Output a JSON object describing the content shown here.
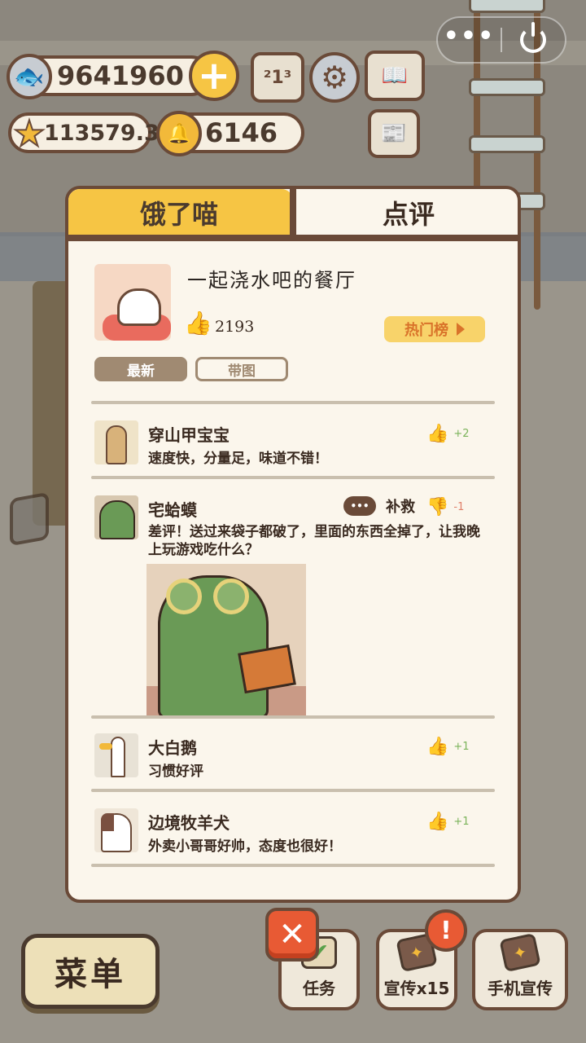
{
  "hud": {
    "fish": "9641960",
    "stars": "113579.3",
    "bells": "6146",
    "plus_label": "+",
    "rank_label": "²1³"
  },
  "panel": {
    "tabs": [
      "饿了喵",
      "点评"
    ],
    "restaurant_name": "一起浇水吧的餐厅",
    "likes": "2193",
    "hot_list_label": "热门榜",
    "filters": [
      "最新",
      "带图"
    ]
  },
  "reviews": [
    {
      "name": "穿山甲宝宝",
      "text": "速度快，分量足，味道不错！",
      "vote": "+2"
    },
    {
      "name": "宅蛤蟆",
      "text": "差评！送过来袋子都破了，里面的东西全掉了，让我晚上玩游戏吃什么？",
      "vote": "-1",
      "remedy": "补救"
    },
    {
      "name": "大白鹅",
      "text": "习惯好评",
      "vote": "+1"
    },
    {
      "name": "边境牧羊犬",
      "text": "外卖小哥哥好帅，态度也很好！",
      "vote": "+1"
    }
  ],
  "bottom": {
    "menu_label": "菜单",
    "task_label": "任务",
    "promo_label": "宣传x15",
    "phone_promo_label": "手机宣传",
    "close_label": "✕",
    "alert_label": "!"
  },
  "capsule": {
    "more_label": "•••"
  },
  "colors": {
    "accent": "#f6c544",
    "panel_bg": "#fbf6ec",
    "border": "#6a4a38",
    "close": "#e85a34",
    "upvote": "#7ab35a",
    "downvote": "#e0806a"
  },
  "icons": {
    "fish": "fish-icon",
    "star": "star-icon",
    "bell": "bell-icon",
    "thumb_up": "thumb-up-icon",
    "thumb_down": "thumb-down-icon",
    "gear": "gear-icon",
    "book": "book-icon",
    "news": "newspaper-icon",
    "power": "power-icon"
  }
}
